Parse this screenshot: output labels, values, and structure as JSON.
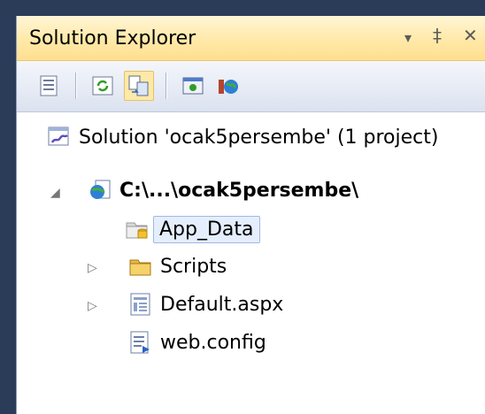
{
  "panel": {
    "title": "Solution Explorer",
    "controls": {
      "dropdown": "▾",
      "pin": "‡",
      "close": "✕"
    }
  },
  "toolbar": {
    "buttons": [
      {
        "icon": "properties-icon"
      },
      {
        "icon": "refresh-icon"
      },
      {
        "icon": "show-all-files-icon",
        "active": true
      },
      {
        "icon": "view-designer-icon"
      },
      {
        "icon": "copy-web-site-icon"
      }
    ]
  },
  "tree": {
    "solution": {
      "label": "Solution 'ocak5persembe' (1 project)"
    },
    "project": {
      "label": "C:\\...\\ocak5persembe\\",
      "expanded": true
    },
    "items": [
      {
        "label": "App_Data",
        "selected": true
      },
      {
        "label": "Scripts",
        "collapsed": true
      },
      {
        "label": "Default.aspx",
        "collapsed": true
      },
      {
        "label": "web.config"
      }
    ]
  },
  "colors": {
    "titlebar": "#ffe9a8",
    "selection": "#e5eefc",
    "frame": "#2b3c59"
  }
}
